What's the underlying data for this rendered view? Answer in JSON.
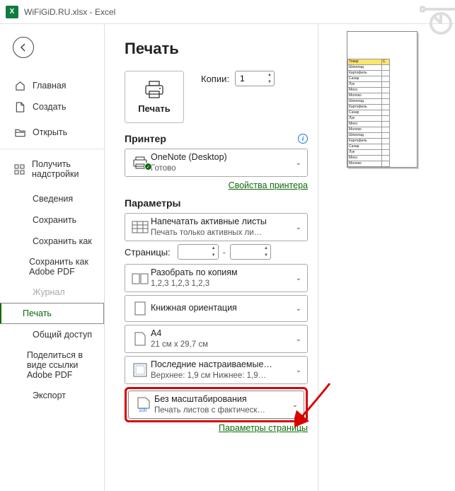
{
  "title": "WiFiGiD.RU.xlsx  -  Excel",
  "sidebar": {
    "home": "Главная",
    "new": "Создать",
    "open": "Открыть",
    "addins": "Получить надстройки",
    "info": "Сведения",
    "save": "Сохранить",
    "saveas": "Сохранить как",
    "saveas_pdf": "Сохранить как Adobe PDF",
    "history": "Журнал",
    "print": "Печать",
    "share": "Общий доступ",
    "share_pdf": "Поделиться в виде ссылки Adobe PDF",
    "export": "Экспорт"
  },
  "page": {
    "title": "Печать",
    "print_label": "Печать",
    "copies_label": "Копии:",
    "copies_value": "1"
  },
  "printer": {
    "section": "Принтер",
    "name": "OneNote (Desktop)",
    "status": "Готово",
    "props_link": "Свойства принтера"
  },
  "params": {
    "section": "Параметры",
    "what_primary": "Напечатать активные листы",
    "what_secondary": "Печать только активных ли…",
    "pages_label": "Страницы:",
    "pages_sep": "-",
    "collate_primary": "Разобрать по копиям",
    "collate_secondary": "1,2,3    1,2,3    1,2,3",
    "orientation": "Книжная ориентация",
    "paper_primary": "A4",
    "paper_secondary": "21 см x 29,7 см",
    "margins_primary": "Последние настраиваемые…",
    "margins_secondary": "Верхнее: 1,9 см Нижнее: 1,9…",
    "scale_primary": "Без масштабирования",
    "scale_secondary": "Печать листов с фактическ…",
    "page_setup_link": "Параметры страницы"
  },
  "preview": {
    "header1": "Товар",
    "header2": "С",
    "rows": [
      "Шоколад",
      "Картофель",
      "Сахар",
      "Лук",
      "Мясо",
      "Молоко",
      "Шоколад",
      "Картофель",
      "Сахар",
      "Лук",
      "Мясо",
      "Молоко",
      "Шоколад",
      "Картофель",
      "Сахар",
      "Лук",
      "Мясо",
      "Молоко"
    ]
  }
}
